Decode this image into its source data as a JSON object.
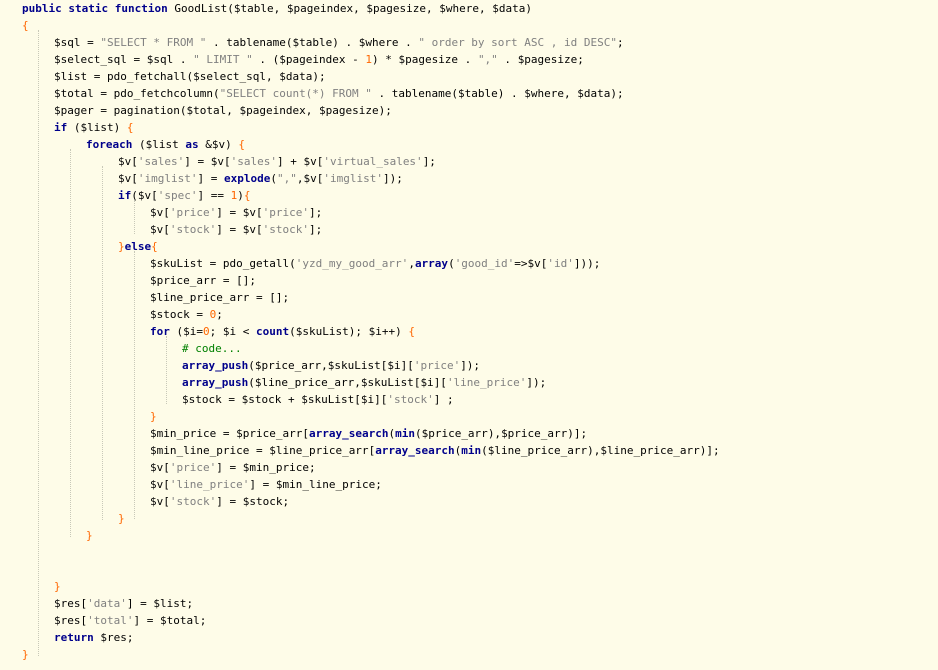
{
  "editor": {
    "language": "php",
    "lines": [
      {
        "indent": 0,
        "tokens": [
          [
            "kw",
            "public static function "
          ],
          [
            "plain",
            "GoodList($table, $pageindex, $pagesize, $where, $data)"
          ]
        ]
      },
      {
        "indent": 0,
        "tokens": [
          [
            "brace",
            "{"
          ]
        ]
      },
      {
        "indent": 1,
        "tokens": [
          [
            "var",
            "$sql"
          ],
          [
            "op",
            " = "
          ],
          [
            "str",
            "\"SELECT * FROM \""
          ],
          [
            "op",
            " . "
          ],
          [
            "fn",
            "tablename"
          ],
          [
            "op",
            "("
          ],
          [
            "var",
            "$table"
          ],
          [
            "op",
            ") . "
          ],
          [
            "var",
            "$where"
          ],
          [
            "op",
            " . "
          ],
          [
            "str",
            "\" order by sort ASC , id DESC\""
          ],
          [
            "op",
            ";"
          ]
        ]
      },
      {
        "indent": 1,
        "tokens": [
          [
            "var",
            "$select_sql"
          ],
          [
            "op",
            " = "
          ],
          [
            "var",
            "$sql"
          ],
          [
            "op",
            " . "
          ],
          [
            "str",
            "\" LIMIT \""
          ],
          [
            "op",
            " . ("
          ],
          [
            "var",
            "$pageindex"
          ],
          [
            "op",
            " - "
          ],
          [
            "num",
            "1"
          ],
          [
            "op",
            ") * "
          ],
          [
            "var",
            "$pagesize"
          ],
          [
            "op",
            " . "
          ],
          [
            "str",
            "\",\""
          ],
          [
            "op",
            " . "
          ],
          [
            "var",
            "$pagesize"
          ],
          [
            "op",
            ";"
          ]
        ]
      },
      {
        "indent": 1,
        "tokens": [
          [
            "var",
            "$list"
          ],
          [
            "op",
            " = "
          ],
          [
            "fn",
            "pdo_fetchall"
          ],
          [
            "op",
            "("
          ],
          [
            "var",
            "$select_sql"
          ],
          [
            "op",
            ", "
          ],
          [
            "var",
            "$data"
          ],
          [
            "op",
            ");"
          ]
        ]
      },
      {
        "indent": 1,
        "tokens": [
          [
            "var",
            "$total"
          ],
          [
            "op",
            " = "
          ],
          [
            "fn",
            "pdo_fetchcolumn"
          ],
          [
            "op",
            "("
          ],
          [
            "str",
            "\"SELECT count(*) FROM \""
          ],
          [
            "op",
            " . "
          ],
          [
            "fn",
            "tablename"
          ],
          [
            "op",
            "("
          ],
          [
            "var",
            "$table"
          ],
          [
            "op",
            ") . "
          ],
          [
            "var",
            "$where"
          ],
          [
            "op",
            ", "
          ],
          [
            "var",
            "$data"
          ],
          [
            "op",
            ");"
          ]
        ]
      },
      {
        "indent": 1,
        "tokens": [
          [
            "var",
            "$pager"
          ],
          [
            "op",
            " = "
          ],
          [
            "fn",
            "pagination"
          ],
          [
            "op",
            "("
          ],
          [
            "var",
            "$total"
          ],
          [
            "op",
            ", "
          ],
          [
            "var",
            "$pageindex"
          ],
          [
            "op",
            ", "
          ],
          [
            "var",
            "$pagesize"
          ],
          [
            "op",
            ");"
          ]
        ]
      },
      {
        "indent": 1,
        "tokens": [
          [
            "kw",
            "if"
          ],
          [
            "op",
            " ("
          ],
          [
            "var",
            "$list"
          ],
          [
            "op",
            ") "
          ],
          [
            "brace",
            "{"
          ]
        ]
      },
      {
        "indent": 2,
        "tokens": [
          [
            "kw",
            "foreach"
          ],
          [
            "op",
            " ("
          ],
          [
            "var",
            "$list"
          ],
          [
            "op",
            " "
          ],
          [
            "kw",
            "as"
          ],
          [
            "op",
            " &"
          ],
          [
            "var",
            "$v"
          ],
          [
            "op",
            ") "
          ],
          [
            "brace",
            "{"
          ]
        ]
      },
      {
        "indent": 3,
        "tokens": [
          [
            "var",
            "$v"
          ],
          [
            "op",
            "["
          ],
          [
            "str",
            "'sales'"
          ],
          [
            "op",
            "] = "
          ],
          [
            "var",
            "$v"
          ],
          [
            "op",
            "["
          ],
          [
            "str",
            "'sales'"
          ],
          [
            "op",
            "] + "
          ],
          [
            "var",
            "$v"
          ],
          [
            "op",
            "["
          ],
          [
            "str",
            "'virtual_sales'"
          ],
          [
            "op",
            "];"
          ]
        ]
      },
      {
        "indent": 3,
        "tokens": [
          [
            "var",
            "$v"
          ],
          [
            "op",
            "["
          ],
          [
            "str",
            "'imglist'"
          ],
          [
            "op",
            "] = "
          ],
          [
            "fnb",
            "explode"
          ],
          [
            "op",
            "("
          ],
          [
            "str",
            "\",\""
          ],
          [
            "op",
            ","
          ],
          [
            "var",
            "$v"
          ],
          [
            "op",
            "["
          ],
          [
            "str",
            "'imglist'"
          ],
          [
            "op",
            "]);"
          ]
        ]
      },
      {
        "indent": 3,
        "tokens": [
          [
            "kw",
            "if"
          ],
          [
            "op",
            "("
          ],
          [
            "var",
            "$v"
          ],
          [
            "op",
            "["
          ],
          [
            "str",
            "'spec'"
          ],
          [
            "op",
            "] == "
          ],
          [
            "num",
            "1"
          ],
          [
            "op",
            ")"
          ],
          [
            "brace",
            "{"
          ]
        ]
      },
      {
        "indent": 4,
        "tokens": [
          [
            "var",
            "$v"
          ],
          [
            "op",
            "["
          ],
          [
            "str",
            "'price'"
          ],
          [
            "op",
            "] = "
          ],
          [
            "var",
            "$v"
          ],
          [
            "op",
            "["
          ],
          [
            "str",
            "'price'"
          ],
          [
            "op",
            "];"
          ]
        ]
      },
      {
        "indent": 4,
        "tokens": [
          [
            "var",
            "$v"
          ],
          [
            "op",
            "["
          ],
          [
            "str",
            "'stock'"
          ],
          [
            "op",
            "] = "
          ],
          [
            "var",
            "$v"
          ],
          [
            "op",
            "["
          ],
          [
            "str",
            "'stock'"
          ],
          [
            "op",
            "];"
          ]
        ]
      },
      {
        "indent": 3,
        "tokens": [
          [
            "brace",
            "}"
          ],
          [
            "kw",
            "else"
          ],
          [
            "brace",
            "{"
          ]
        ]
      },
      {
        "indent": 4,
        "tokens": [
          [
            "var",
            "$skuList"
          ],
          [
            "op",
            " = "
          ],
          [
            "fn",
            "pdo_getall"
          ],
          [
            "op",
            "("
          ],
          [
            "str",
            "'yzd_my_good_arr'"
          ],
          [
            "op",
            ","
          ],
          [
            "kw",
            "array"
          ],
          [
            "op",
            "("
          ],
          [
            "str",
            "'good_id'"
          ],
          [
            "op",
            "=>"
          ],
          [
            "var",
            "$v"
          ],
          [
            "op",
            "["
          ],
          [
            "str",
            "'id'"
          ],
          [
            "op",
            "]));"
          ]
        ]
      },
      {
        "indent": 4,
        "tokens": [
          [
            "var",
            "$price_arr"
          ],
          [
            "op",
            " = [];"
          ]
        ]
      },
      {
        "indent": 4,
        "tokens": [
          [
            "var",
            "$line_price_arr"
          ],
          [
            "op",
            " = [];"
          ]
        ]
      },
      {
        "indent": 4,
        "tokens": [
          [
            "var",
            "$stock"
          ],
          [
            "op",
            " = "
          ],
          [
            "num",
            "0"
          ],
          [
            "op",
            ";"
          ]
        ]
      },
      {
        "indent": 4,
        "tokens": [
          [
            "kw",
            "for"
          ],
          [
            "op",
            " ("
          ],
          [
            "var",
            "$i"
          ],
          [
            "op",
            "="
          ],
          [
            "num",
            "0"
          ],
          [
            "op",
            "; "
          ],
          [
            "var",
            "$i"
          ],
          [
            "op",
            " < "
          ],
          [
            "fnb",
            "count"
          ],
          [
            "op",
            "("
          ],
          [
            "var",
            "$skuList"
          ],
          [
            "op",
            "); "
          ],
          [
            "var",
            "$i"
          ],
          [
            "op",
            "++) "
          ],
          [
            "brace",
            "{"
          ]
        ]
      },
      {
        "indent": 5,
        "tokens": [
          [
            "cmt",
            "# code..."
          ]
        ]
      },
      {
        "indent": 5,
        "tokens": [
          [
            "fnb",
            "array_push"
          ],
          [
            "op",
            "("
          ],
          [
            "var",
            "$price_arr"
          ],
          [
            "op",
            ","
          ],
          [
            "var",
            "$skuList"
          ],
          [
            "op",
            "["
          ],
          [
            "var",
            "$i"
          ],
          [
            "op",
            "]["
          ],
          [
            "str",
            "'price'"
          ],
          [
            "op",
            "]);"
          ]
        ]
      },
      {
        "indent": 5,
        "tokens": [
          [
            "fnb",
            "array_push"
          ],
          [
            "op",
            "("
          ],
          [
            "var",
            "$line_price_arr"
          ],
          [
            "op",
            ","
          ],
          [
            "var",
            "$skuList"
          ],
          [
            "op",
            "["
          ],
          [
            "var",
            "$i"
          ],
          [
            "op",
            "]["
          ],
          [
            "str",
            "'line_price'"
          ],
          [
            "op",
            "]);"
          ]
        ]
      },
      {
        "indent": 5,
        "tokens": [
          [
            "var",
            "$stock"
          ],
          [
            "op",
            " = "
          ],
          [
            "var",
            "$stock"
          ],
          [
            "op",
            " + "
          ],
          [
            "var",
            "$skuList"
          ],
          [
            "op",
            "["
          ],
          [
            "var",
            "$i"
          ],
          [
            "op",
            "]["
          ],
          [
            "str",
            "'stock'"
          ],
          [
            "op",
            "] ;"
          ]
        ]
      },
      {
        "indent": 4,
        "tokens": [
          [
            "brace",
            "}"
          ]
        ]
      },
      {
        "indent": 4,
        "tokens": [
          [
            "var",
            "$min_price"
          ],
          [
            "op",
            " = "
          ],
          [
            "var",
            "$price_arr"
          ],
          [
            "op",
            "["
          ],
          [
            "fnb",
            "array_search"
          ],
          [
            "op",
            "("
          ],
          [
            "fnb",
            "min"
          ],
          [
            "op",
            "("
          ],
          [
            "var",
            "$price_arr"
          ],
          [
            "op",
            "),"
          ],
          [
            "var",
            "$price_arr"
          ],
          [
            "op",
            ")];"
          ]
        ]
      },
      {
        "indent": 4,
        "tokens": [
          [
            "var",
            "$min_line_price"
          ],
          [
            "op",
            " = "
          ],
          [
            "var",
            "$line_price_arr"
          ],
          [
            "op",
            "["
          ],
          [
            "fnb",
            "array_search"
          ],
          [
            "op",
            "("
          ],
          [
            "fnb",
            "min"
          ],
          [
            "op",
            "("
          ],
          [
            "var",
            "$line_price_arr"
          ],
          [
            "op",
            "),"
          ],
          [
            "var",
            "$line_price_arr"
          ],
          [
            "op",
            ")];"
          ]
        ]
      },
      {
        "indent": 4,
        "tokens": [
          [
            "var",
            "$v"
          ],
          [
            "op",
            "["
          ],
          [
            "str",
            "'price'"
          ],
          [
            "op",
            "] = "
          ],
          [
            "var",
            "$min_price"
          ],
          [
            "op",
            ";"
          ]
        ]
      },
      {
        "indent": 4,
        "tokens": [
          [
            "var",
            "$v"
          ],
          [
            "op",
            "["
          ],
          [
            "str",
            "'line_price'"
          ],
          [
            "op",
            "] = "
          ],
          [
            "var",
            "$min_line_price"
          ],
          [
            "op",
            ";"
          ]
        ]
      },
      {
        "indent": 4,
        "tokens": [
          [
            "var",
            "$v"
          ],
          [
            "op",
            "["
          ],
          [
            "str",
            "'stock'"
          ],
          [
            "op",
            "] = "
          ],
          [
            "var",
            "$stock"
          ],
          [
            "op",
            ";"
          ]
        ]
      },
      {
        "indent": 3,
        "tokens": [
          [
            "brace",
            "}"
          ]
        ]
      },
      {
        "indent": 2,
        "tokens": [
          [
            "brace",
            "}"
          ]
        ]
      },
      {
        "indent": 0,
        "tokens": []
      },
      {
        "indent": 0,
        "tokens": []
      },
      {
        "indent": 1,
        "tokens": [
          [
            "brace",
            "}"
          ]
        ]
      },
      {
        "indent": 1,
        "tokens": [
          [
            "var",
            "$res"
          ],
          [
            "op",
            "["
          ],
          [
            "str",
            "'data'"
          ],
          [
            "op",
            "] = "
          ],
          [
            "var",
            "$list"
          ],
          [
            "op",
            ";"
          ]
        ]
      },
      {
        "indent": 1,
        "tokens": [
          [
            "var",
            "$res"
          ],
          [
            "op",
            "["
          ],
          [
            "str",
            "'total'"
          ],
          [
            "op",
            "] = "
          ],
          [
            "var",
            "$total"
          ],
          [
            "op",
            ";"
          ]
        ]
      },
      {
        "indent": 1,
        "tokens": [
          [
            "kw",
            "return"
          ],
          [
            "op",
            " "
          ],
          [
            "var",
            "$res"
          ],
          [
            "op",
            ";"
          ]
        ]
      },
      {
        "indent": 0,
        "tokens": [
          [
            "brace",
            "}"
          ]
        ]
      }
    ]
  }
}
